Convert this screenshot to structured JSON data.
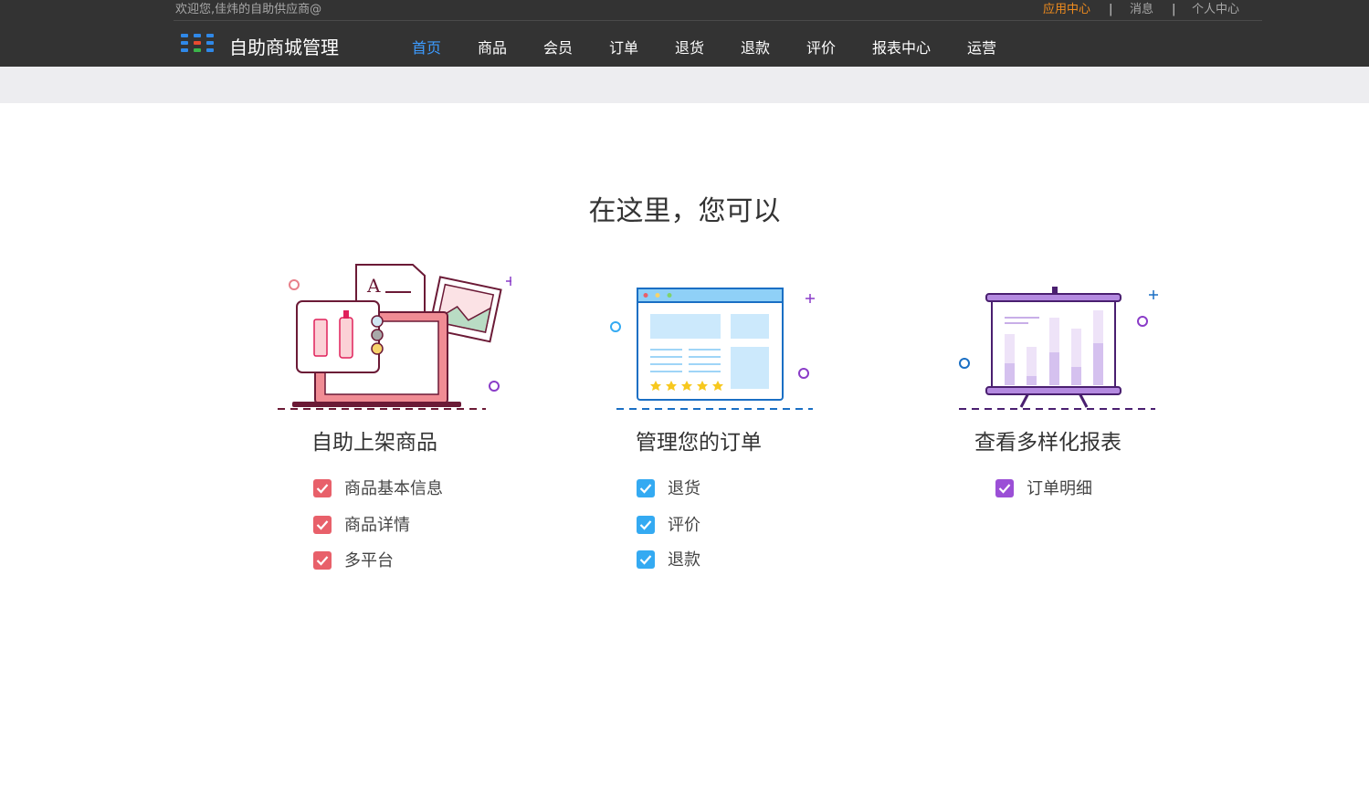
{
  "header": {
    "welcome": "欢迎您,佳炜的自助供应商@",
    "links": [
      {
        "label": "应用中心",
        "active": true
      },
      {
        "label": "消息",
        "active": false
      },
      {
        "label": "个人中心",
        "active": false
      }
    ],
    "separator": "|",
    "brand": "自助商城管理",
    "nav": [
      "首页",
      "商品",
      "会员",
      "订单",
      "退货",
      "退款",
      "评价",
      "报表中心",
      "运营"
    ],
    "active_nav": "首页"
  },
  "main": {
    "headline": "在这里，您可以",
    "features": [
      {
        "title": "自助上架商品",
        "icon": "product-listing-illustration",
        "check_color": "#e8606a",
        "items": [
          "商品基本信息",
          "商品详情",
          "多平台"
        ]
      },
      {
        "title": "管理您的订单",
        "icon": "order-management-illustration",
        "check_color": "#34aaf2",
        "items": [
          "退货",
          "评价",
          "退款"
        ]
      },
      {
        "title": "查看多样化报表",
        "icon": "report-presentation-illustration",
        "check_color": "#9b4fd6",
        "items": [
          "订单明细"
        ]
      }
    ]
  },
  "colors": {
    "topbar": "#333333",
    "nav_active": "#3c9bff",
    "link_active": "#f08c1e",
    "band": "#ededf0"
  }
}
